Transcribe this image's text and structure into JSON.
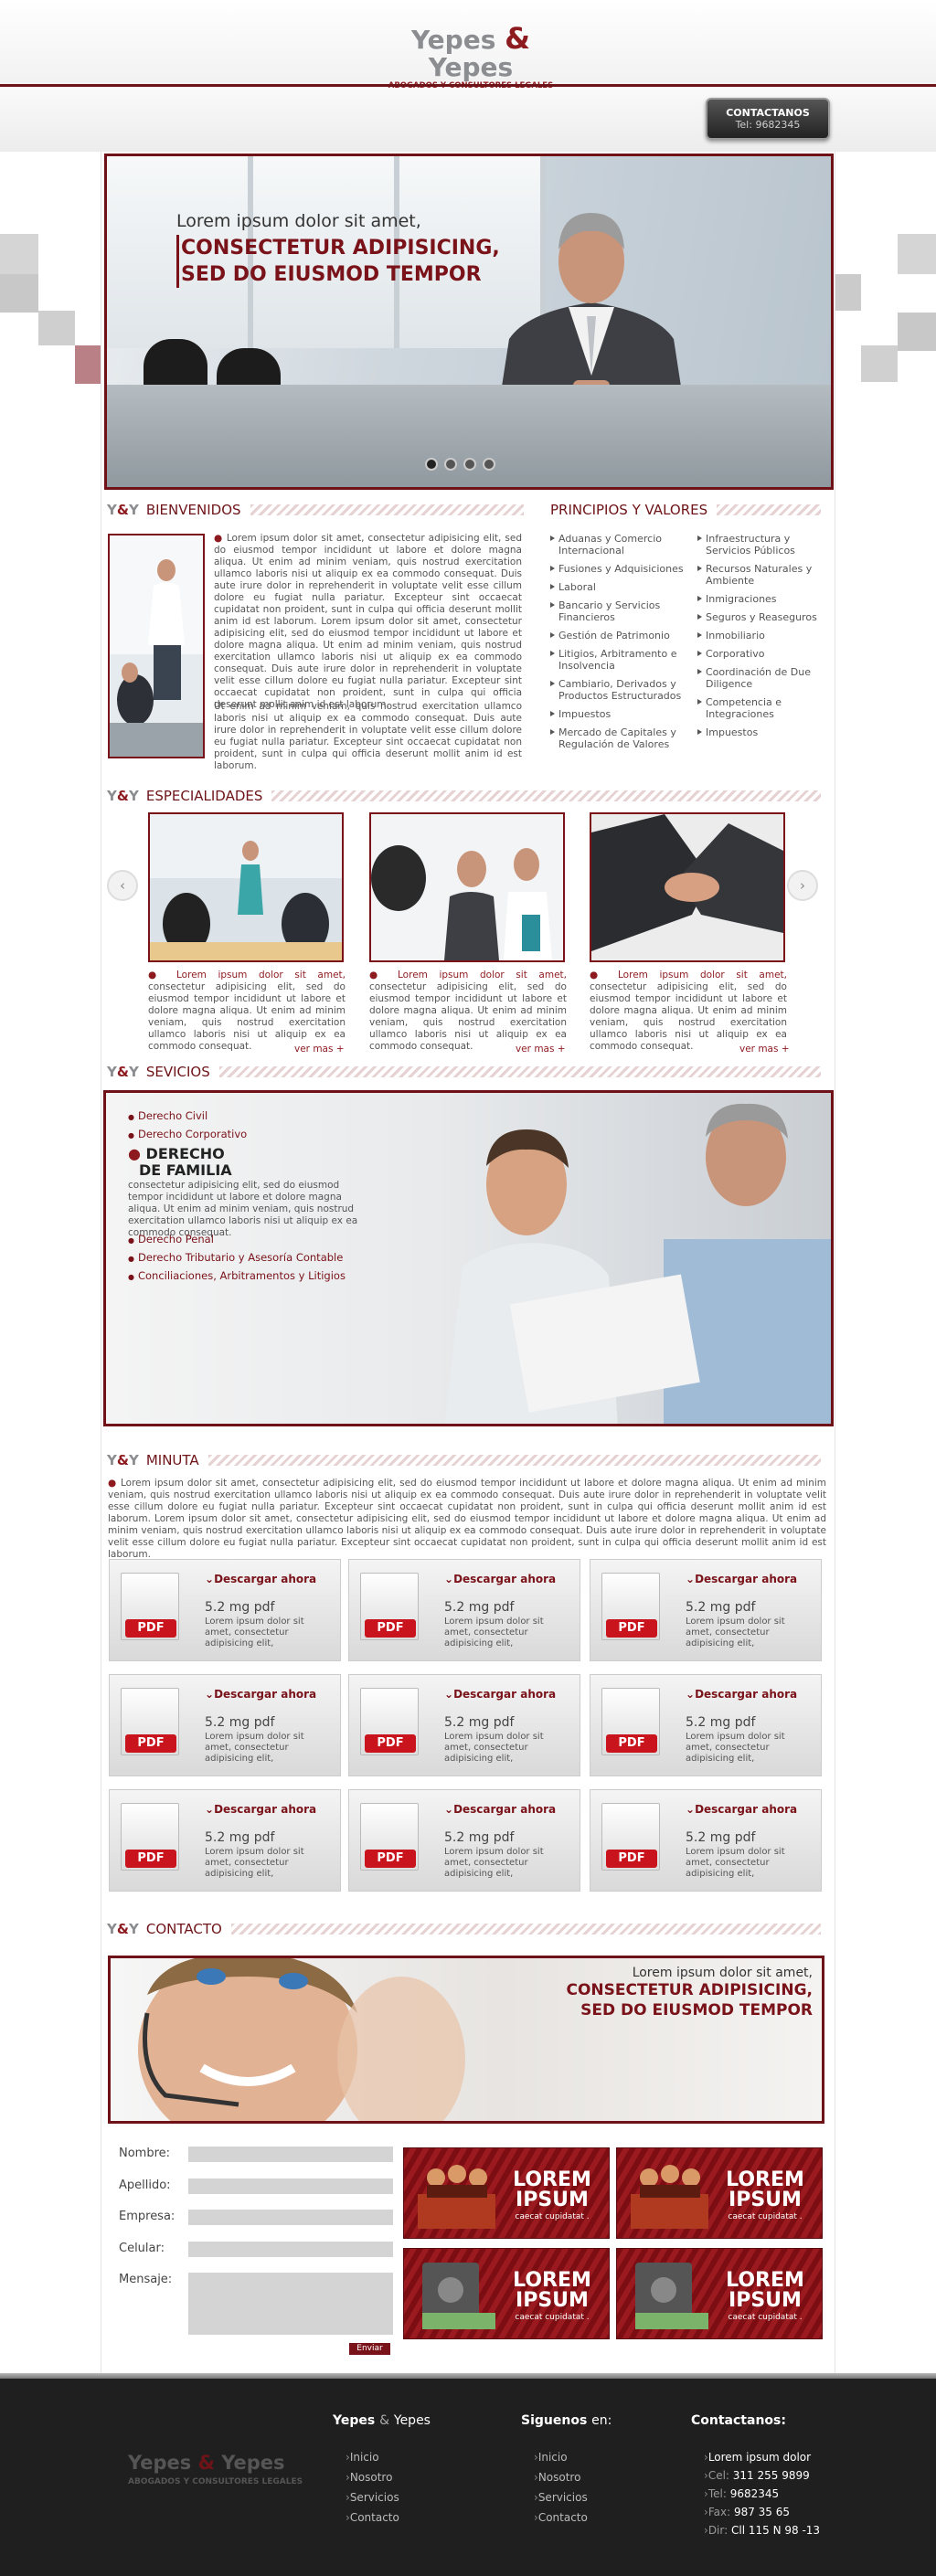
{
  "header": {
    "logo_main_1": "Yepes",
    "logo_amp": "&",
    "logo_main_2": "Yepes",
    "logo_sub": "ABOGADOS Y CONSULTORES LEGALES",
    "contact_button": {
      "label": "CONTACTANOS",
      "phone": "Tel: 9682345"
    }
  },
  "hero": {
    "line1": "Lorem ipsum dolor sit amet,",
    "line2": "CONSECTETUR ADIPISICING,",
    "line3": "SED DO EIUSMOD TEMPOR",
    "slides": 4
  },
  "bienvenidos": {
    "yy": "Y",
    "amp": "&",
    "yy2": "Y",
    "title": "BIENVENIDOS",
    "p1": "Lorem ipsum dolor sit amet, consectetur adipisicing elit, sed do eiusmod tempor incididunt ut labore et dolore magna aliqua. Ut enim ad minim veniam, quis nostrud exercitation ullamco laboris nisi ut aliquip ex ea commodo consequat. Duis aute irure dolor in reprehenderit in voluptate velit esse cillum dolore eu fugiat nulla pariatur. Excepteur sint occaecat cupidatat non proident, sunt in culpa qui officia deserunt mollit anim id est laborum. Lorem ipsum dolor sit amet, consectetur adipisicing elit, sed do eiusmod tempor incididunt ut labore et dolore magna aliqua. Ut enim ad minim veniam, quis nostrud exercitation ullamco laboris nisi ut aliquip ex ea commodo consequat. Duis aute irure dolor in reprehenderit in voluptate velit esse cillum dolore eu fugiat nulla pariatur. Excepteur sint occaecat cupidatat non proident, sunt in culpa qui officia deserunt mollit anim id est laborum.",
    "p2": "Ut enim ad minim veniam, quis nostrud exercitation ullamco laboris nisi ut aliquip ex ea commodo consequat. Duis aute irure dolor in reprehenderit in voluptate velit esse cillum dolore eu fugiat nulla pariatur. Excepteur sint occaecat cupidatat non proident, sunt in culpa qui officia deserunt mollit anim id est laborum."
  },
  "principios": {
    "title": "PRINCIPIOS Y VALORES",
    "left": [
      "Aduanas y Comercio Internacional",
      "Fusiones y Adquisiciones",
      "Laboral",
      "Bancario y Servicios Financieros",
      "Gestión de Patrimonio",
      "Litigios, Arbitramento e Insolvencia",
      "Cambiario, Derivados y Productos Estructurados",
      "Impuestos",
      "Mercado de Capitales y Regulación de Valores"
    ],
    "right": [
      "Infraestructura y Servicios Públicos",
      "Recursos Naturales y Ambiente",
      "Inmigraciones",
      "Seguros y Reaseguros",
      "Inmobiliario",
      "Corporativo",
      "Coordinación de Due Diligence",
      "Competencia e Integraciones",
      "Impuestos"
    ]
  },
  "especialidades": {
    "title": "ESPECIALIDADES",
    "cards": [
      {
        "bold": "Lorem ipsum dolor sit amet,",
        "text": "consectetur adipisicing elit, sed do eiusmod tempor incididunt ut labore et dolore magna aliqua. Ut enim ad minim veniam, quis nostrud exercitation ullamco laboris nisi ut aliquip ex ea commodo consequat.",
        "more": "ver mas +"
      },
      {
        "bold": "Lorem ipsum dolor sit amet,",
        "text": "consectetur adipisicing elit, sed do eiusmod tempor incididunt ut labore et dolore magna aliqua. Ut enim ad minim veniam, quis nostrud exercitation ullamco laboris nisi ut aliquip ex ea commodo consequat.",
        "more": "ver mas +"
      },
      {
        "bold": "Lorem ipsum dolor sit amet,",
        "text": "consectetur adipisicing elit, sed do eiusmod tempor incididunt ut labore et dolore magna aliqua. Ut enim ad minim veniam, quis nostrud exercitation ullamco laboris nisi ut aliquip ex ea commodo consequat.",
        "more": "ver mas +"
      }
    ]
  },
  "servicios": {
    "title": "SEVICIOS",
    "items": [
      "Derecho Civil",
      "Derecho Corporativo"
    ],
    "featured_1": "DERECHO",
    "featured_2": "DE FAMILIA",
    "featured_text": "consectetur adipisicing elit, sed do eiusmod tempor incididunt ut labore et dolore magna aliqua. Ut enim ad minim veniam, quis nostrud exercitation ullamco laboris nisi ut aliquip ex ea commodo consequat.",
    "items2": [
      "Derecho Penal",
      "Derecho Tributario y Asesoría Contable",
      "Conciliaciones, Arbitramentos y Litigios"
    ]
  },
  "minuta": {
    "title": "MINUTA",
    "text": "Lorem ipsum dolor sit amet, consectetur adipisicing elit, sed do eiusmod tempor incididunt ut labore et dolore magna aliqua. Ut enim ad minim veniam, quis nostrud exercitation ullamco laboris nisi ut aliquip ex ea commodo consequat. Duis aute irure dolor in reprehenderit in voluptate velit esse cillum dolore eu fugiat nulla pariatur. Excepteur sint occaecat cupidatat non proident, sunt in culpa qui officia deserunt mollit anim id est laborum. Lorem ipsum dolor sit amet, consectetur adipisicing elit, sed do eiusmod tempor incididunt ut labore et dolore magna aliqua. Ut enim ad minim veniam, quis nostrud exercitation ullamco laboris nisi ut aliquip ex ea commodo consequat. Duis aute irure dolor in reprehenderit in voluptate velit esse cillum dolore eu fugiat nulla pariatur. Excepteur sint occaecat cupidatat non proident, sunt in culpa qui officia deserunt mollit anim id est laborum.",
    "download": {
      "label": "Descargar ahora",
      "size": "5.2 mg pdf",
      "desc": "Lorem ipsum dolor sit amet, consectetur adipisicing elit,",
      "badge": "PDF"
    }
  },
  "contacto": {
    "title": "CONTACTO",
    "ban1": "Lorem ipsum dolor sit amet,",
    "ban2": "CONSECTETUR ADIPISICING,",
    "ban3": "SED DO EIUSMOD TEMPOR",
    "labels": [
      "Nombre:",
      "Apellido:",
      "Empresa:",
      "Celular:",
      "Mensaje:"
    ],
    "send": "Enviar",
    "ad": {
      "big1": "LOREM",
      "big2": "IPSUM",
      "small": "caecat cupidatat ."
    }
  },
  "footer": {
    "logo_main_1": "Yepes",
    "logo_amp": "&",
    "logo_main_2": "Yepes",
    "logo_sub": "ABOGADOS Y CONSULTORES LEGALES",
    "col1": {
      "h1": "Yepes",
      "amp": "&",
      "h2": "Yepes",
      "links": [
        "Inicio",
        "Nosotro",
        "Servicios",
        "Contacto"
      ]
    },
    "col2": {
      "h1": "Siguenos",
      "h2": "en:",
      "links": [
        "Inicio",
        "Nosotro",
        "Servicios",
        "Contacto"
      ]
    },
    "col3": {
      "h": "Contactanos:",
      "name": "Lorem ipsum dolor",
      "rows": [
        {
          "k": "Cel:",
          "v": "311 255 9899"
        },
        {
          "k": "Tel:",
          "v": "9682345"
        },
        {
          "k": "Fax:",
          "v": "987 35 65"
        },
        {
          "k": "Dir:",
          "v": "Cll 115 N 98 -13"
        }
      ]
    }
  }
}
